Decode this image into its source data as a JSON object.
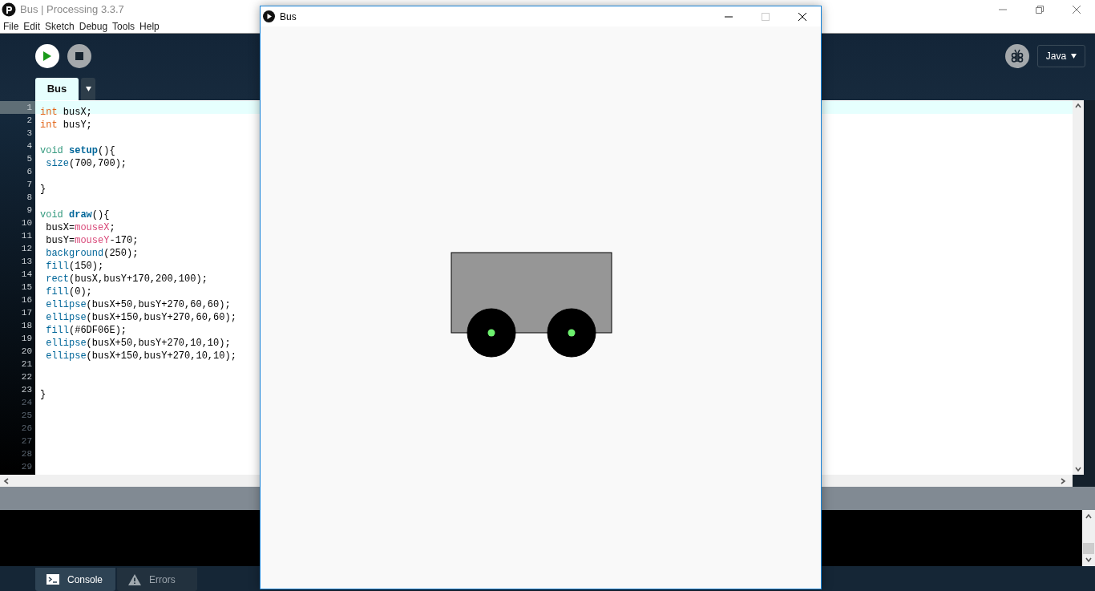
{
  "window": {
    "title": "Bus | Processing 3.3.7"
  },
  "menu": [
    "File",
    "Edit",
    "Sketch",
    "Debug",
    "Tools",
    "Help"
  ],
  "editor_tabs": [
    {
      "label": "Bus",
      "selected": true
    }
  ],
  "mode": "Java",
  "code_lines": [
    {
      "number": "1",
      "selected": true,
      "dim": false,
      "tokens": [
        {
          "kind": "type",
          "text": "int"
        },
        {
          "kind": "plain",
          "text": " busX;"
        }
      ]
    },
    {
      "number": "2",
      "selected": false,
      "dim": false,
      "tokens": [
        {
          "kind": "type",
          "text": "int"
        },
        {
          "kind": "plain",
          "text": " busY;"
        }
      ]
    },
    {
      "number": "3",
      "selected": false,
      "dim": false
    },
    {
      "number": "4",
      "selected": false,
      "dim": false,
      "tokens": [
        {
          "kind": "keyword",
          "text": "void"
        },
        {
          "kind": "method",
          "text": " setup"
        },
        {
          "kind": "plain",
          "text": "(){"
        }
      ]
    },
    {
      "number": "5",
      "selected": false,
      "dim": false,
      "tokens": [
        {
          "kind": "function",
          "text": " size"
        },
        {
          "kind": "plain",
          "text": "(700,700);"
        }
      ]
    },
    {
      "number": "6",
      "selected": false,
      "dim": false
    },
    {
      "number": "7",
      "selected": false,
      "dim": false,
      "tokens": [
        {
          "kind": "plain",
          "text": "}"
        }
      ]
    },
    {
      "number": "8",
      "selected": false,
      "dim": false
    },
    {
      "number": "9",
      "selected": false,
      "dim": false,
      "tokens": [
        {
          "kind": "keyword",
          "text": "void"
        },
        {
          "kind": "method",
          "text": " draw"
        },
        {
          "kind": "plain",
          "text": "(){"
        }
      ]
    },
    {
      "number": "10",
      "selected": false,
      "dim": false,
      "tokens": [
        {
          "kind": "plain",
          "text": " busX="
        },
        {
          "kind": "variable",
          "text": "mouseX"
        },
        {
          "kind": "plain",
          "text": ";"
        }
      ]
    },
    {
      "number": "11",
      "selected": false,
      "dim": false,
      "tokens": [
        {
          "kind": "plain",
          "text": " busY="
        },
        {
          "kind": "variable",
          "text": "mouseY"
        },
        {
          "kind": "plain",
          "text": "-170;"
        }
      ]
    },
    {
      "number": "12",
      "selected": false,
      "dim": false,
      "tokens": [
        {
          "kind": "function",
          "text": " background"
        },
        {
          "kind": "plain",
          "text": "(250);"
        }
      ]
    },
    {
      "number": "13",
      "selected": false,
      "dim": false,
      "tokens": [
        {
          "kind": "function",
          "text": " fill"
        },
        {
          "kind": "plain",
          "text": "(150);"
        }
      ]
    },
    {
      "number": "14",
      "selected": false,
      "dim": false,
      "tokens": [
        {
          "kind": "function",
          "text": " rect"
        },
        {
          "kind": "plain",
          "text": "(busX,busY+170,200,100);"
        }
      ]
    },
    {
      "number": "15",
      "selected": false,
      "dim": false,
      "tokens": [
        {
          "kind": "function",
          "text": " fill"
        },
        {
          "kind": "plain",
          "text": "(0);"
        }
      ]
    },
    {
      "number": "16",
      "selected": false,
      "dim": false,
      "tokens": [
        {
          "kind": "function",
          "text": " ellipse"
        },
        {
          "kind": "plain",
          "text": "(busX+50,busY+270,60,60);"
        }
      ]
    },
    {
      "number": "17",
      "selected": false,
      "dim": false,
      "tokens": [
        {
          "kind": "function",
          "text": " ellipse"
        },
        {
          "kind": "plain",
          "text": "(busX+150,busY+270,60,60);"
        }
      ]
    },
    {
      "number": "18",
      "selected": false,
      "dim": false,
      "tokens": [
        {
          "kind": "function",
          "text": " fill"
        },
        {
          "kind": "plain",
          "text": "(#6DF06E);"
        }
      ]
    },
    {
      "number": "19",
      "selected": false,
      "dim": false,
      "tokens": [
        {
          "kind": "function",
          "text": " ellipse"
        },
        {
          "kind": "plain",
          "text": "(busX+50,busY+270,10,10);"
        }
      ]
    },
    {
      "number": "20",
      "selected": false,
      "dim": false,
      "tokens": [
        {
          "kind": "function",
          "text": " ellipse"
        },
        {
          "kind": "plain",
          "text": "(busX+150,busY+270,10,10);"
        }
      ]
    },
    {
      "number": "21",
      "selected": false,
      "dim": false
    },
    {
      "number": "22",
      "selected": false,
      "dim": false
    },
    {
      "number": "23",
      "selected": false,
      "dim": false,
      "tokens": [
        {
          "kind": "plain",
          "text": "}"
        }
      ]
    },
    {
      "number": "24",
      "selected": false,
      "dim": true
    },
    {
      "number": "25",
      "selected": false,
      "dim": true
    },
    {
      "number": "26",
      "selected": false,
      "dim": true
    },
    {
      "number": "27",
      "selected": false,
      "dim": true
    },
    {
      "number": "28",
      "selected": false,
      "dim": true
    },
    {
      "number": "29",
      "selected": false,
      "dim": true
    }
  ],
  "console_tabs": [
    {
      "kind": "console",
      "label": "Console",
      "selected": true
    },
    {
      "kind": "errors",
      "label": "Errors",
      "selected": false
    }
  ],
  "sketch_window": {
    "title": "Bus"
  }
}
